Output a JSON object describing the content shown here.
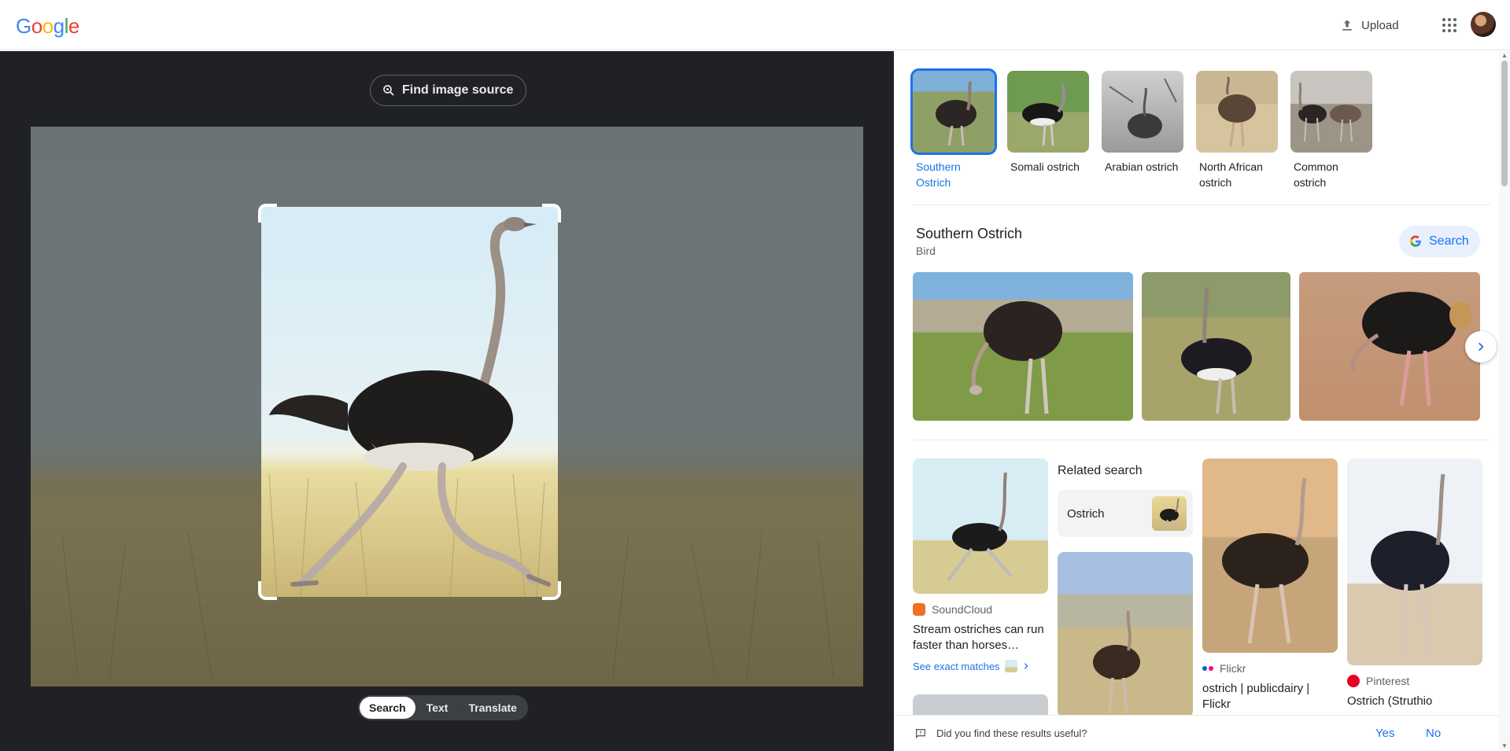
{
  "header": {
    "logo_letters": [
      "G",
      "o",
      "o",
      "g",
      "l",
      "e"
    ],
    "upload_label": "Upload"
  },
  "lens": {
    "find_source_label": "Find image source",
    "modes": [
      {
        "label": "Search",
        "active": true
      },
      {
        "label": "Text",
        "active": false
      },
      {
        "label": "Translate",
        "active": false
      }
    ]
  },
  "entities": [
    {
      "label": "Southern Ostrich",
      "active": true
    },
    {
      "label": "Somali ostrich",
      "active": false
    },
    {
      "label": "Arabian ostrich",
      "active": false
    },
    {
      "label": "North African ostrich",
      "active": false
    },
    {
      "label": "Common ostrich",
      "active": false
    }
  ],
  "knowledge_panel": {
    "title": "Southern Ostrich",
    "subtitle": "Bird",
    "search_label": "Search"
  },
  "results": [
    {
      "source": "SoundCloud",
      "title": "Stream ostriches can run faster than horses…",
      "exact_label": "See exact matches",
      "color": "#f26f23"
    },
    {
      "source": "Flickr",
      "title": "ostrich | publicdairy | Flickr",
      "color": "#0063dc"
    },
    {
      "source": "Pinterest",
      "title": "Ostrich (Struthio",
      "color": "#e60023"
    }
  ],
  "related": {
    "heading": "Related search",
    "chip_label": "Ostrich"
  },
  "feedback": {
    "question": "Did you find these results useful?",
    "yes_label": "Yes",
    "no_label": "No"
  },
  "colors": {
    "accent": "#1a73e8",
    "dark_bg": "#202124"
  }
}
